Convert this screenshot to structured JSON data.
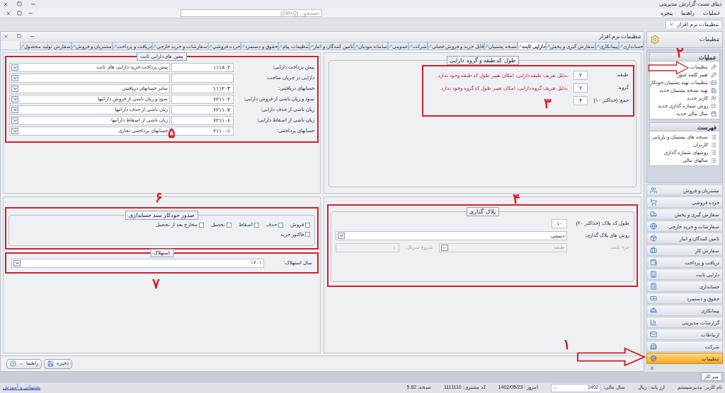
{
  "app": {
    "title": "دیتای تست گزارش مدیریتی"
  },
  "menu": [
    {
      "label": "عملیات"
    },
    {
      "label": "راهنما"
    },
    {
      "label": "پنجره"
    }
  ],
  "search": {
    "placeholder": "جستجو... (Ctrl+Q)"
  },
  "document_tab": {
    "label": "تنظیمات نرم افزار"
  },
  "window": {
    "title": "تنظیمات نرم افزار"
  },
  "tabs": [
    {
      "label": "حسابداری",
      "selected": false
    },
    {
      "label": "پیمانکاری",
      "selected": false
    },
    {
      "label": "سفارش گیری و پخش",
      "selected": false
    },
    {
      "label": "دارایی ثابت",
      "selected": true
    },
    {
      "label": "نسخه پشتیبان",
      "selected": false
    },
    {
      "label": "قابل خرید و فروش فصلی",
      "selected": false
    },
    {
      "label": "شرکت",
      "selected": false
    },
    {
      "label": "عمومی",
      "selected": false
    },
    {
      "label": "سامانه مودیان",
      "selected": false
    },
    {
      "label": "تامین کنندگان و انبار",
      "selected": false
    },
    {
      "label": "تنظیمات پیام",
      "selected": false
    },
    {
      "label": "حقوق و دستمزد",
      "selected": false
    },
    {
      "label": "خرده فروشی",
      "selected": false
    },
    {
      "label": "سفارشات و خرید خارجی",
      "selected": false
    },
    {
      "label": "دریافت و پرداخت",
      "selected": false
    },
    {
      "label": "مشتریان و فروش",
      "selected": false
    },
    {
      "label": "سفارش تولید محصول",
      "selected": false
    }
  ],
  "class_group_length": {
    "title": "طول کد طبقه و گروه دارایی",
    "marker": "۳",
    "rows": [
      {
        "label": "طبقه:",
        "value": "۲",
        "note": "بدلیل تعریف طبقه دارایی، امکان تغییر طول کد طبقه وجود ندارد."
      },
      {
        "label": "گروه:",
        "value": "۲",
        "note": "بدلیل تعریف گروه دارایی، امکان تغییر طول کد گروه وجود ندارد."
      }
    ],
    "total": {
      "label": "جمع: (حداکثر ۱۰)",
      "value": "۴"
    }
  },
  "plate_numbering": {
    "title": "پلاک گذاری",
    "marker": "۴",
    "length": {
      "label": "طول کد پلاک: (حداکثر ۲۰)",
      "value": "۱۰"
    },
    "method": {
      "label": "روش های پلاک گذاری:",
      "value": "دستی"
    },
    "fixed_part": {
      "label": "جزء ثابت:",
      "disabled": true,
      "value": "طبقه",
      "serial_label": "شروع سریال:",
      "serial_value": "۱"
    }
  },
  "accounts": {
    "title": "معین های دارایی ثابت",
    "marker": "۵",
    "rows": [
      {
        "label": "پیش پرداخت دارایی:",
        "code": "۱۱۱۸۰۲",
        "name": "پیش پرداخت خرید دارایی های ثابت"
      },
      {
        "label": "دارایی در جریان ساخت:"
      },
      {
        "label": "حسابهای دریافتنی:",
        "code": "۱۱۱۲۰۴",
        "name": "سایر حسابهای دریافتنی"
      },
      {
        "label": "سود و زیان ناشی از فروش دارایی:",
        "code": "۶۲۱۱۰۲",
        "name": "سود و زیان ناشی از فروش دارائیها"
      },
      {
        "label": "زیان ناشی از حذف دارایی:",
        "code": "۶۲۱۱۰۷",
        "name": "زیان ناشی از حذف دارائیها"
      },
      {
        "label": "زیان ناشی از اسقاط دارایی:",
        "code": "۶۲۱۱۰۶",
        "name": "زیان ناشی از اسقاط دارائیها"
      },
      {
        "label": "حسابهای پرداختنی:",
        "code": "۲۱۱۰۰۱",
        "name": "حسابهای پرداختنی تجاری"
      }
    ]
  },
  "auto_voucher": {
    "title": "صدور خودکار سند حسابداری",
    "marker": "۶",
    "options": [
      {
        "label": "فروش",
        "checked": false
      },
      {
        "label": "حذف",
        "checked": false
      },
      {
        "label": "اسقاط",
        "checked": false
      },
      {
        "label": "تحصیل",
        "checked": false
      },
      {
        "label": "مخارج بعد از تحصیل",
        "checked": false
      },
      {
        "label": "فاکتور خرید",
        "checked": false
      }
    ]
  },
  "depreciation": {
    "title": "استهلاک",
    "marker": "۷",
    "year": {
      "label": "سال استهلاک:",
      "value": "۱۴۰۱"
    }
  },
  "buttons": [
    {
      "label": "ذخیره",
      "kind": "save"
    },
    {
      "label": "راهنما",
      "kind": "help"
    }
  ],
  "sidebar": {
    "title": "تنظیمات",
    "marker": "۲",
    "sections": [
      {
        "title": "عملیات",
        "items": [
          {
            "label": "تنظیمات"
          },
          {
            "label": "تغییر کلمه عبور"
          },
          {
            "label": "تنظیمات تهیه پشتیبان خودکار"
          },
          {
            "label": "تهیه نسخه پشتیبان جدید"
          },
          {
            "label": "کاربر جدید"
          },
          {
            "label": "روش شماره گذاری جدید"
          },
          {
            "label": "سال مالی جدید"
          }
        ]
      },
      {
        "title": "فهرست",
        "items": [
          {
            "label": "نسخه های پشتیبان و بازیابی"
          },
          {
            "label": "کاربران"
          },
          {
            "label": "روشهای شماره گذاری"
          },
          {
            "label": "سالهای مالی"
          }
        ]
      }
    ],
    "nav_marker": "۱",
    "nav": [
      {
        "label": "مشتریان و فروش",
        "selected": false
      },
      {
        "label": "خرده فروشی",
        "selected": false
      },
      {
        "label": "سفارش گیری و پخش",
        "selected": false
      },
      {
        "label": "سفارشات و خرید خارجی",
        "selected": false
      },
      {
        "label": "تامین کنندگان و انبار",
        "selected": false
      },
      {
        "label": "سفارش کار",
        "selected": false
      },
      {
        "label": "دریافت و پرداخت",
        "selected": false
      },
      {
        "label": "دارایی ثابت",
        "selected": false
      },
      {
        "label": "حسابداری",
        "selected": false
      },
      {
        "label": "حقوق و دستمزد",
        "selected": false
      },
      {
        "label": "پیمانکاری",
        "selected": false
      },
      {
        "label": "گزارشات مدیریتی",
        "selected": false
      },
      {
        "label": "ارتباطات",
        "selected": false
      },
      {
        "label": "شرکت",
        "selected": false
      },
      {
        "label": "تنظیمات",
        "selected": true
      }
    ]
  },
  "taskbar": {
    "label": "میز کار"
  },
  "status_bar": {
    "user": "نام کاربر: مدیرسیستم",
    "currency": "ارز پایه : ریال",
    "fiscal_label": "سال مالی:",
    "fiscal_year": "1402",
    "today": "امروز : 1402/05/23",
    "customer": "کد مشتری: 1111110",
    "version": "نسخه: 5.82",
    "support": "پشتیبانی و آموزش"
  }
}
